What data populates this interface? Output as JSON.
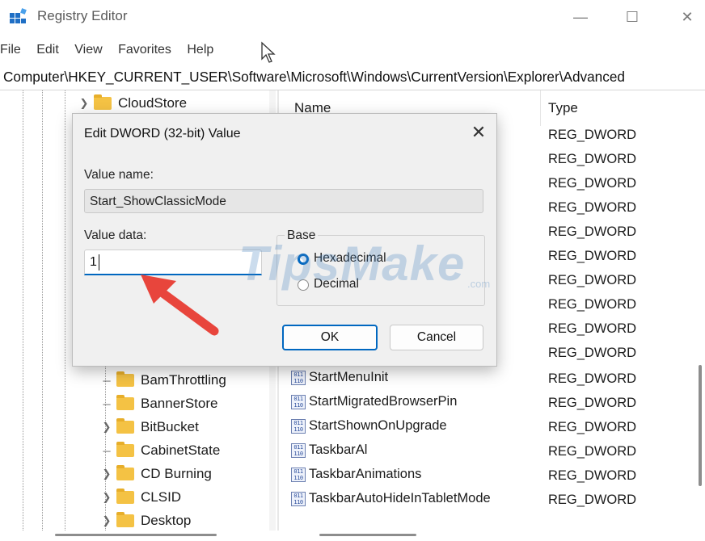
{
  "window": {
    "title": "Registry Editor",
    "controls": {
      "minimize": "—",
      "maximize": "☐",
      "close": "✕"
    }
  },
  "menu": [
    "File",
    "Edit",
    "View",
    "Favorites",
    "Help"
  ],
  "address": "Computer\\HKEY_CURRENT_USER\\Software\\Microsoft\\Windows\\CurrentVersion\\Explorer\\Advanced",
  "tree": {
    "top_item": {
      "label": "CloudStore",
      "has_children": true
    },
    "items": [
      {
        "label": "BamThrottling",
        "has_children": false
      },
      {
        "label": "BannerStore",
        "has_children": false
      },
      {
        "label": "BitBucket",
        "has_children": true
      },
      {
        "label": "CabinetState",
        "has_children": false
      },
      {
        "label": "CD Burning",
        "has_children": true
      },
      {
        "label": "CLSID",
        "has_children": true
      },
      {
        "label": "Desktop",
        "has_children": true
      }
    ]
  },
  "list": {
    "columns": {
      "name": "Name",
      "type": "Type"
    },
    "hidden_types": [
      "REG_DWORD",
      "REG_DWORD",
      "REG_DWORD",
      "REG_DWORD",
      "REG_DWORD",
      "REG_DWORD",
      "REG_DWORD",
      "REG_DWORD",
      "REG_DWORD",
      "REG_DWORD"
    ],
    "rows": [
      {
        "name": "StartMenuInit",
        "type": "REG_DWORD"
      },
      {
        "name": "StartMigratedBrowserPin",
        "type": "REG_DWORD"
      },
      {
        "name": "StartShownOnUpgrade",
        "type": "REG_DWORD"
      },
      {
        "name": "TaskbarAl",
        "type": "REG_DWORD"
      },
      {
        "name": "TaskbarAnimations",
        "type": "REG_DWORD"
      },
      {
        "name": "TaskbarAutoHideInTabletMode",
        "type": "REG_DWORD"
      }
    ],
    "icon": "reg-binary-icon",
    "icon_text": "011\n110"
  },
  "dialog": {
    "title": "Edit DWORD (32-bit) Value",
    "value_name_label": "Value name:",
    "value_name": "Start_ShowClassicMode",
    "value_data_label": "Value data:",
    "value_data": "1",
    "base_label": "Base",
    "base_options": {
      "hex": "Hexadecimal",
      "dec": "Decimal"
    },
    "selected_base": "hex",
    "ok": "OK",
    "cancel": "Cancel",
    "close": "✕"
  },
  "watermark": {
    "main": "TipsMake",
    "sub": ".com"
  },
  "colors": {
    "accent": "#0067c0",
    "arrow": "#e8453c",
    "folder": "#f4c244"
  }
}
